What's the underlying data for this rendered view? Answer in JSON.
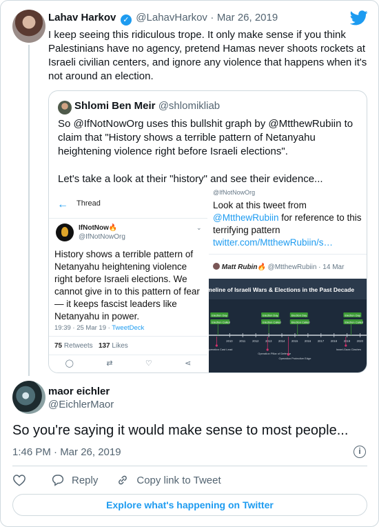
{
  "tweet1": {
    "name": "Lahav Harkov",
    "handle": "@LahavHarkov",
    "date": "Mar 26, 2019",
    "text": "I keep seeing this ridiculous trope. It only make sense if you think Palestinians have no agency, pretend Hamas never shoots rockets at Israeli civilian centers, and ignore any violence that happens when it's not around an election."
  },
  "quote": {
    "name": "Shlomi Ben Meir",
    "handle": "@shlomikliab",
    "text": "So @IfNotNowOrg uses this bullshit graph by @MtthewRubiin to claim that \"History shows a terrible pattern of Netanyahu heightening violence right before Israeli elections\".\n\nLet's take a look at their \"history\" and see their evidence...",
    "image_left": {
      "back": "←",
      "thread": "Thread",
      "name": "IfNotNow🔥",
      "handle": "@IfNotNowOrg",
      "body": "History shows a terrible pattern of Netanyahu heightening violence right before Israeli elections. We cannot give in to this pattern of fear — it keeps fascist leaders like Netanyahu in power.",
      "meta_time": "19:39 · 25 Mar 19 · ",
      "meta_client": "TweetDeck",
      "retweets_count": "75",
      "retweets_label": "Retweets",
      "likes_count": "137",
      "likes_label": "Likes"
    },
    "image_right_top": {
      "handle": "@IfNotNowOrg",
      "text_before": "Look at this tweet from ",
      "mention": "@MtthewRubiin",
      "text_middle": " for reference to this terrifying pattern ",
      "link": "twitter.com/MtthewRubiin/s…",
      "author_name": "Matt Rubin🔥",
      "author_handle": "@MtthewRubiin · 14 Mar"
    },
    "image_right_bottom": {
      "title": "Timeline of Israeli Wars & Elections in the Past Decade",
      "elections": [
        {
          "label": "Election Day",
          "x": 2009.1
        },
        {
          "label": "Election Day",
          "x": 2013.0
        },
        {
          "label": "Election Day",
          "x": 2015.2
        },
        {
          "label": "Election Day",
          "x": 2019.3
        }
      ],
      "election_called": [
        "Election Called",
        "Election Called",
        "Election Called",
        "Election Called"
      ],
      "years": [
        "2010",
        "2011",
        "2012",
        "2013",
        "2014",
        "2015",
        "2016",
        "2017",
        "2018",
        "2019",
        "2020"
      ],
      "operations": [
        "Operation Cast Lead",
        "Operation Pillar of Defense",
        "Operation Protective Edge",
        "Israel-Gaza Clashes"
      ],
      "colors": {
        "bg": "#1d2a3a",
        "header": "#2b3a4c",
        "election": "#3c9a35",
        "operation": "#d0316a"
      }
    }
  },
  "tweet2": {
    "name": "maor eichler",
    "handle": "@EichlerMaor",
    "text": "So you're saying it would make sense to most people...",
    "time": "1:46 PM · Mar 26, 2019",
    "reply": "Reply",
    "copy_link": "Copy link to Tweet",
    "explore": "Explore what's happening on Twitter"
  },
  "colors": {
    "accent": "#1d9bf0",
    "muted": "#536471",
    "border": "#cfd9de"
  }
}
